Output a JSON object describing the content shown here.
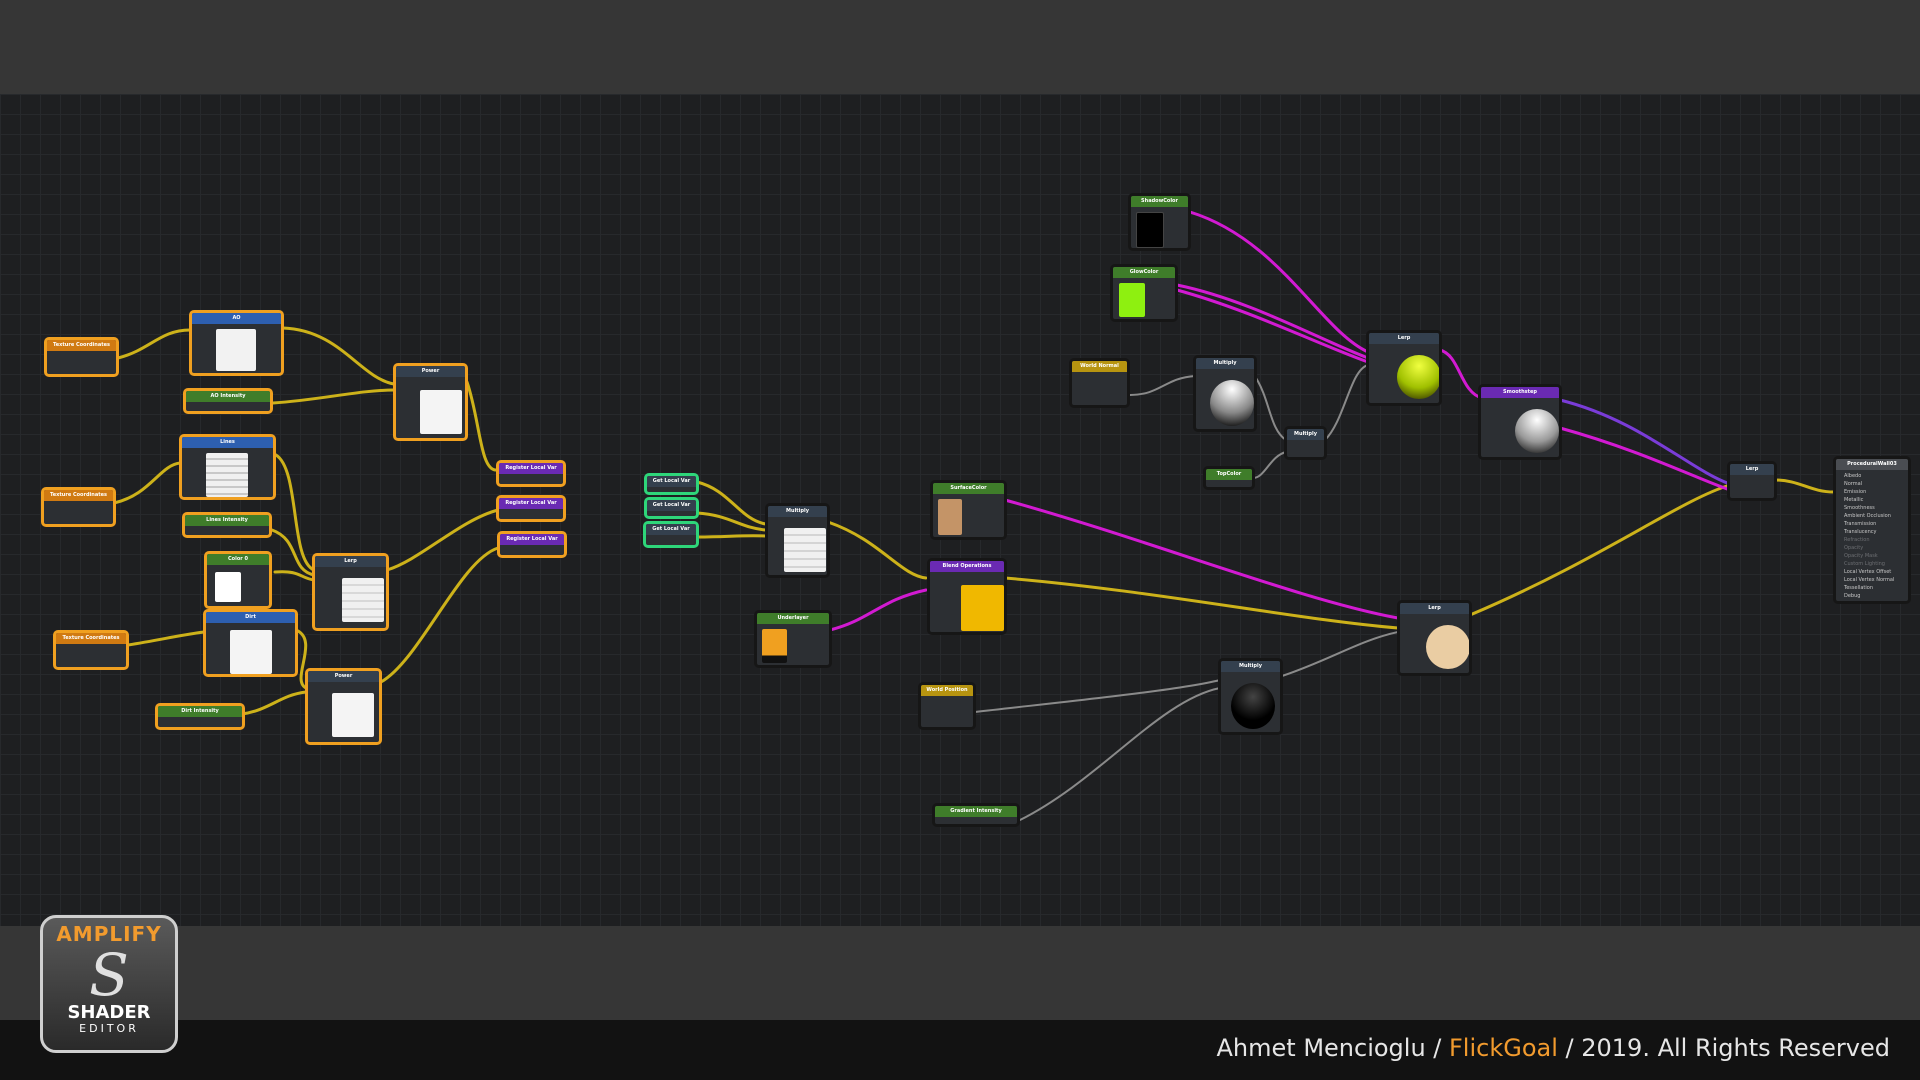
{
  "footer": {
    "author": "Ahmet Mencioglu / ",
    "studio": "FlickGoal",
    "rights": " / 2019. All Rights Reserved"
  },
  "logo": {
    "top": "AMPLIFY",
    "mark": "S",
    "middle": "SHADER",
    "bottom": "EDITOR"
  },
  "nodes": {
    "texcoord1": "Texture Coordinates",
    "texcoord2": "Texture Coordinates",
    "texcoord3": "Texture Coordinates",
    "sample_top": "AO",
    "ao_intensity": "AO Intensity",
    "power1": "Power",
    "sample_lines": "Lines",
    "lines_intensity": "Lines Intensity",
    "color0": "Color 0",
    "lerp_left": "Lerp",
    "sample_dirt": "Dirt",
    "dirt_intensity": "Dirt Intensity",
    "power2": "Power",
    "register1": "Register Local Var",
    "register2": "Register Local Var",
    "register3": "Register Local Var",
    "get1": "Get Local Var",
    "get2": "Get Local Var",
    "get3": "Get Local Var",
    "multiply_mid": "Multiply",
    "surface_color": "SurfaceColor",
    "blend_ops": "Blend Operations",
    "underlayer": "Underlayer",
    "world_position": "World Position",
    "gradient_intensity": "Gradient Intensity",
    "multiply_bottom": "Multiply",
    "lerp_bottom": "Lerp",
    "shadow_color": "ShadowColor",
    "glow_color": "GlowColor",
    "world_normal": "World Normal",
    "multiply_ball": "Multiply",
    "multiply_small": "Multiply",
    "top_color": "TopColor",
    "lerp_green": "Lerp",
    "smoothstep": "Smoothstep",
    "lerp_final": "Lerp",
    "output": "ProceduralWall03"
  },
  "output_ports": [
    "Albedo",
    "Normal",
    "Emission",
    "Metallic",
    "Smoothness",
    "Ambient Occlusion",
    "Transmission",
    "Translucency",
    "Refraction",
    "Opacity",
    "Opacity Mask",
    "Custom Lighting",
    "Local Vertex Offset",
    "Local Vertex Normal",
    "Tessellation",
    "Debug"
  ],
  "colors": {
    "wire_yellow": "#cdb21a",
    "wire_magenta": "#d21ad2",
    "wire_grey": "#8a8a8a",
    "wire_purple": "#7a3cd8",
    "selection": "#f0a020",
    "accent": "#f29b2e"
  }
}
